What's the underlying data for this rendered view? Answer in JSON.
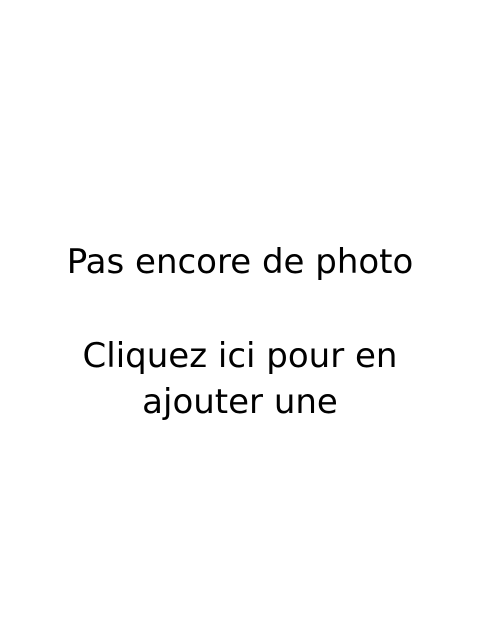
{
  "placeholder": {
    "title": "Pas encore de photo",
    "cta": "Cliquez ici pour en ajouter une"
  }
}
